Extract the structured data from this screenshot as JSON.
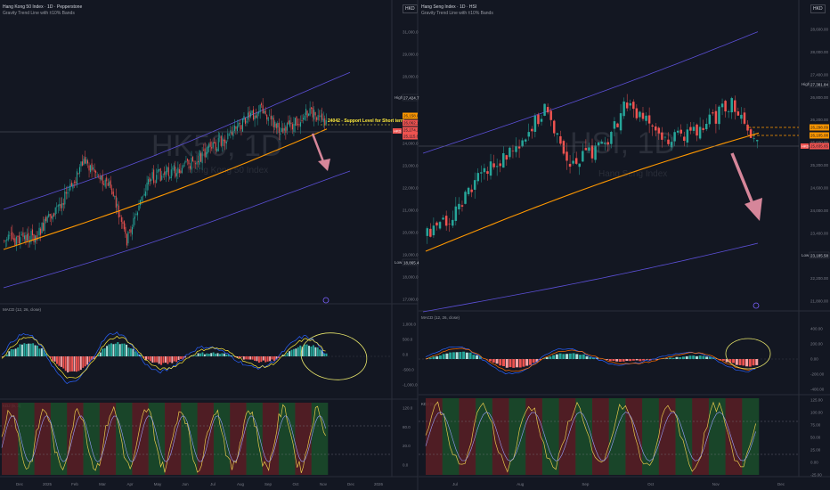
{
  "left": {
    "title": "Hang Kong 50 Index · 1D · Pepperstone",
    "indicator": "Gravity Trend Line with ±10% Bands",
    "currency": "HKD",
    "watermark": "HK50, 1D",
    "watermark_sub": "Hong Kong 50 Index",
    "annotation": "24042 - Support Level for Short term",
    "macd_label": "MACD (12, 26, close)",
    "kdj_label": "KDJ (9, 3)",
    "price_ticks": [
      "31,000.0",
      "29,000.0",
      "28,000.0",
      "26,000.0",
      "25,000.0",
      "24,000.0",
      "23,000.0",
      "22,000.0",
      "21,000.0",
      "20,000.0",
      "19,000.0",
      "18,000.0",
      "17,000.0"
    ],
    "high_tag": "High",
    "high_value": "27,424.7",
    "low_tag": "Low",
    "low_value": "18,865.4",
    "level_tags": [
      "26,158.8",
      "26,062.1",
      "25,274.2",
      "25,115.6"
    ],
    "hkd_tag": "HKD",
    "macd_ticks": [
      "1,000.0",
      "500.0",
      "0.0",
      "-500.0",
      "-1,000.0"
    ],
    "kdj_ticks": [
      "120.0",
      "80.0",
      "20.0",
      "0.0"
    ],
    "time_ticks": [
      "Dec",
      "2025",
      "Feb",
      "Mar",
      "Apr",
      "May",
      "Jun",
      "Jul",
      "Aug",
      "Sep",
      "Oct",
      "Nov",
      "Dec",
      "2026"
    ]
  },
  "right": {
    "title": "Hang Seng Index · 1D · HSI",
    "indicator": "Gravity Trend Line with ±10% Bands",
    "currency": "HKD",
    "watermark": "HSI, 1D",
    "watermark_sub": "Hang Seng Index",
    "macd_label": "MACD (12, 26, close)",
    "kdj_label": "KDJ (9, 3)",
    "price_ticks": [
      "28,600.00",
      "28,000.00",
      "27,400.00",
      "26,800.00",
      "26,200.00",
      "25,600.00",
      "25,200.00",
      "24,600.00",
      "24,000.00",
      "23,400.00",
      "22,800.00",
      "22,200.00",
      "21,800.00"
    ],
    "high_tag": "High",
    "high_value": "27,381.84",
    "low_tag": "Low",
    "low_value": "23,185.58",
    "level_tags": [
      "26,298.09",
      "26,105.08",
      "25,835.65"
    ],
    "hkd_tag": "HKD",
    "macd_ticks": [
      "400.00",
      "200.00",
      "0.00",
      "-200.00",
      "-400.00"
    ],
    "kdj_ticks": [
      "125.00",
      "100.00",
      "75.00",
      "50.00",
      "25.00",
      "0.00",
      "-25.00"
    ],
    "time_ticks": [
      "Jul",
      "Aug",
      "Sep",
      "Oct",
      "Nov",
      "Dec"
    ]
  },
  "colors": {
    "background": "#131722",
    "up": "#26a69a",
    "down": "#ef5350",
    "trend_line": "#ff9800",
    "band_line": "#5b4fd6",
    "macd_line": "#2962ff",
    "signal_line": "#ff6d00",
    "annotation": "#ffeb3b",
    "arrow": "#d6869a"
  }
}
